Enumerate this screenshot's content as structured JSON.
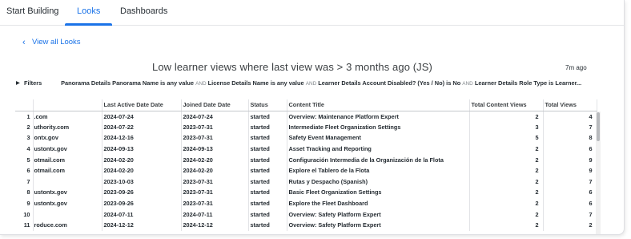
{
  "tabs": [
    {
      "label": "Start Building"
    },
    {
      "label": "Looks"
    },
    {
      "label": "Dashboards"
    }
  ],
  "active_tab": "Looks",
  "accent_color": "#1a73e8",
  "back_link": {
    "label": "View all Looks",
    "icon": "chevron-left-icon"
  },
  "look": {
    "title": "Low learner views where last view was > 3 months ago (JS)",
    "age": "7m ago"
  },
  "filters": {
    "label": "Filters",
    "and_word": "AND",
    "expressions": [
      "Panorama Details Panorama Name is any value",
      "License Details Name is any value",
      "Learner Details Account Disabled? (Yes / No) is No",
      "Learner Details Role Type is Learner..."
    ]
  },
  "table": {
    "columns": [
      "",
      "",
      "Last Active Date Date",
      "Joined Date Date",
      "Status",
      "Content Title",
      "Total Content Views",
      "Total Views"
    ],
    "rows": [
      {
        "n": "1",
        "email": ".com",
        "last_active": "2024-07-24",
        "joined": "2024-07-24",
        "status": "started",
        "title": "Overview: Maintenance Platform Expert",
        "content_views": "2",
        "total_views": "4"
      },
      {
        "n": "2",
        "email": "uthority.com",
        "last_active": "2024-07-22",
        "joined": "2023-07-31",
        "status": "started",
        "title": "Intermediate Fleet Organization Settings",
        "content_views": "3",
        "total_views": "7"
      },
      {
        "n": "3",
        "email": "ontx.gov",
        "last_active": "2024-12-16",
        "joined": "2023-07-31",
        "status": "started",
        "title": "Safety Event Management",
        "content_views": "5",
        "total_views": "8"
      },
      {
        "n": "4",
        "email": "ustontx.gov",
        "last_active": "2024-09-13",
        "joined": "2024-09-13",
        "status": "started",
        "title": "Asset Tracking and Reporting",
        "content_views": "2",
        "total_views": "6"
      },
      {
        "n": "5",
        "email": "otmail.com",
        "last_active": "2024-02-20",
        "joined": "2024-02-20",
        "status": "started",
        "title": "Configuración Intermedia de la Organización de la Flota",
        "content_views": "2",
        "total_views": "9"
      },
      {
        "n": "6",
        "email": "otmail.com",
        "last_active": "2024-02-20",
        "joined": "2024-02-20",
        "status": "started",
        "title": "Explore el Tablero de la Flota",
        "content_views": "2",
        "total_views": "9"
      },
      {
        "n": "7",
        "email": "",
        "last_active": "2023-10-03",
        "joined": "2023-07-31",
        "status": "started",
        "title": "Rutas y Despacho (Spanish)",
        "content_views": "2",
        "total_views": "7"
      },
      {
        "n": "8",
        "email": "ustontx.gov",
        "last_active": "2023-09-26",
        "joined": "2023-07-31",
        "status": "started",
        "title": "Basic Fleet Organization Settings",
        "content_views": "2",
        "total_views": "6"
      },
      {
        "n": "9",
        "email": "ustontx.gov",
        "last_active": "2023-09-26",
        "joined": "2023-07-31",
        "status": "started",
        "title": "Explore the Fleet Dashboard",
        "content_views": "2",
        "total_views": "6"
      },
      {
        "n": "10",
        "email": "",
        "last_active": "2024-07-11",
        "joined": "2024-07-11",
        "status": "started",
        "title": "Overview: Safety Platform Expert",
        "content_views": "2",
        "total_views": "7"
      },
      {
        "n": "11",
        "email": "roduce.com",
        "last_active": "2024-12-12",
        "joined": "2024-12-12",
        "status": "started",
        "title": "Overview: Safety Platform Expert",
        "content_views": "2",
        "total_views": "2"
      }
    ]
  }
}
